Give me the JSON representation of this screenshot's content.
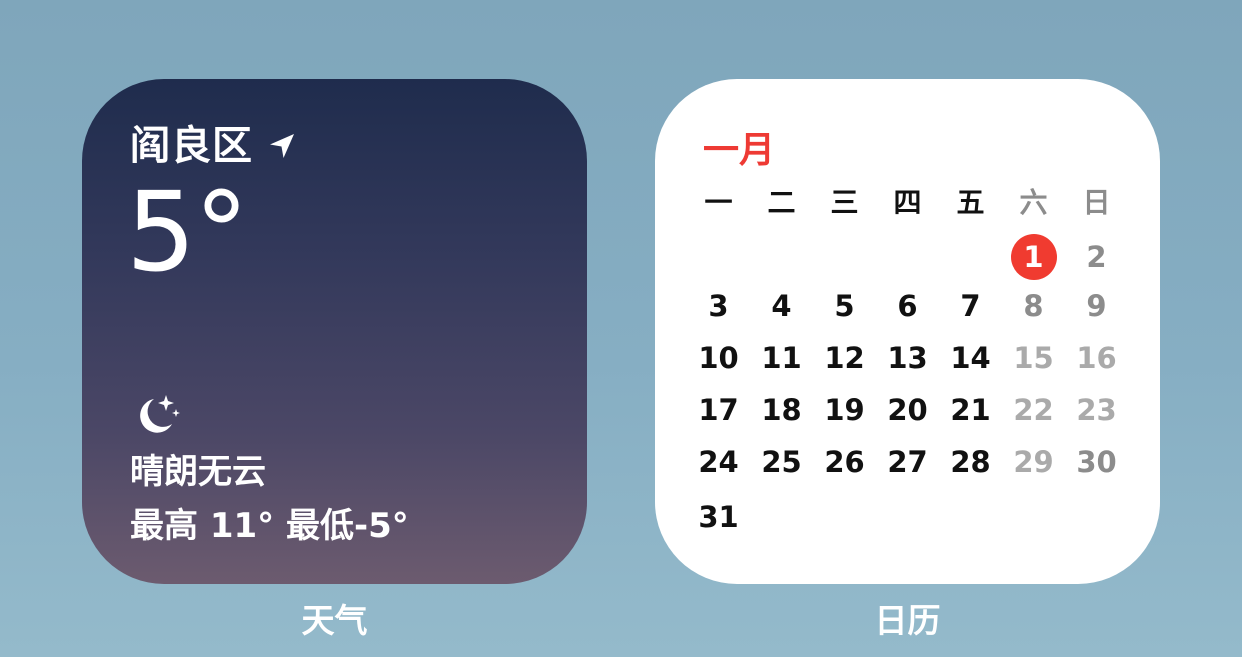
{
  "weather": {
    "location": "阎良区",
    "temperature": "5°",
    "condition": "晴朗无云",
    "high_low": "最高 11° 最低-5°",
    "location_icon": "location-arrow-icon",
    "condition_icon": "moon-stars-icon",
    "label": "天气"
  },
  "calendar": {
    "month": "一月",
    "label": "日历",
    "accent_color": "#ee3a34",
    "weekdays": [
      "一",
      "二",
      "三",
      "四",
      "五",
      "六",
      "日"
    ],
    "today": "1",
    "weeks": [
      [
        "",
        "",
        "",
        "",
        "",
        "1",
        "2"
      ],
      [
        "3",
        "4",
        "5",
        "6",
        "7",
        "8",
        "9"
      ],
      [
        "10",
        "11",
        "12",
        "13",
        "14",
        "15",
        "16"
      ],
      [
        "17",
        "18",
        "19",
        "20",
        "21",
        "22",
        "23"
      ],
      [
        "24",
        "25",
        "26",
        "27",
        "28",
        "29",
        "30"
      ],
      [
        "31",
        "",
        "",
        "",
        "",
        "",
        ""
      ]
    ]
  }
}
